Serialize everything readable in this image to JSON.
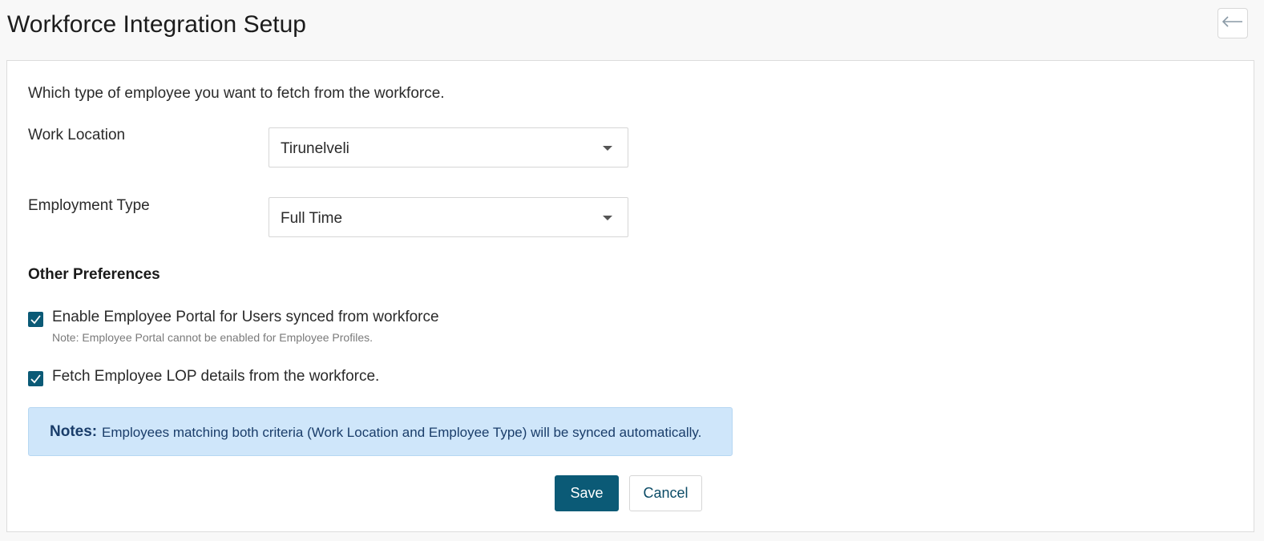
{
  "header": {
    "title": "Workforce Integration Setup",
    "back_icon": "arrow-left-icon"
  },
  "form": {
    "intro": "Which type of employee you want to fetch from the workforce.",
    "work_location": {
      "label": "Work Location",
      "value": "Tirunelveli"
    },
    "employment_type": {
      "label": "Employment Type",
      "value": "Full Time"
    }
  },
  "preferences": {
    "heading": "Other Preferences",
    "options": [
      {
        "label": "Enable Employee Portal for Users synced from workforce",
        "checked": true,
        "note": "Note: Employee Portal cannot be enabled for Employee Profiles."
      },
      {
        "label": "Fetch Employee LOP details from the workforce.",
        "checked": true
      }
    ]
  },
  "notes": {
    "title": "Notes:",
    "text": "Employees matching both criteria (Work Location and Employee Type) will be synced automatically."
  },
  "actions": {
    "save_label": "Save",
    "cancel_label": "Cancel"
  },
  "colors": {
    "primary": "#0b5a76",
    "notes_background": "#cfe6fa",
    "notes_text": "#1a3d6a"
  }
}
